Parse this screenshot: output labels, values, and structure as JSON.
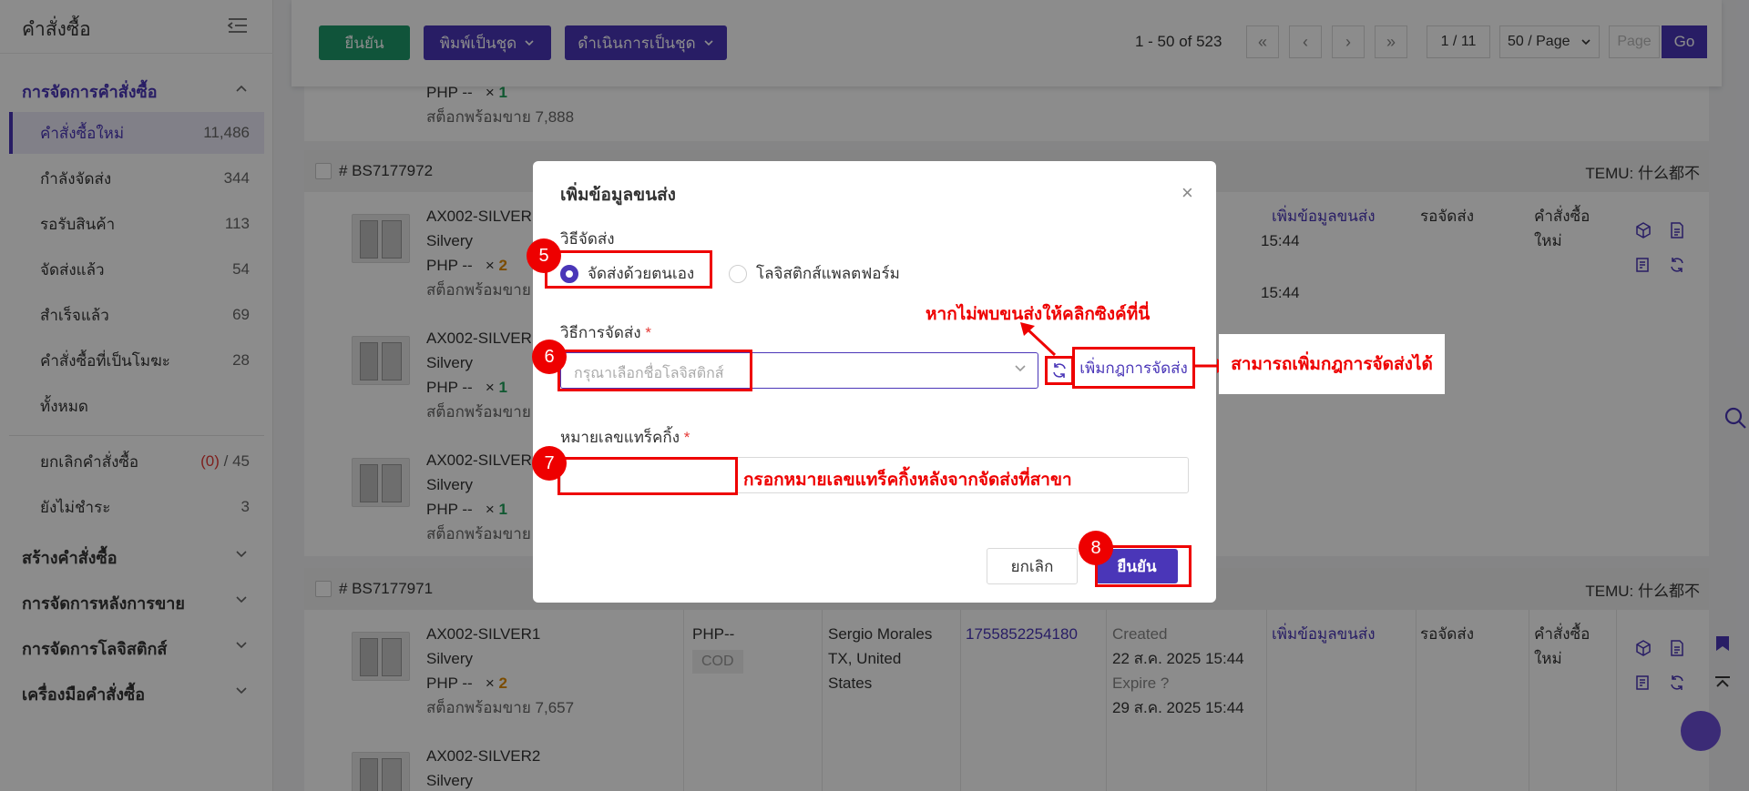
{
  "sidebar": {
    "title": "คำสั่งซื้อ",
    "section_active": "การจัดการคำสั่งซื้อ",
    "items": [
      {
        "label": "คำสั่งซื้อใหม่",
        "count": "11,486"
      },
      {
        "label": "กำลังจัดส่ง",
        "count": "344"
      },
      {
        "label": "รอรับสินค้า",
        "count": "113"
      },
      {
        "label": "จัดส่งแล้ว",
        "count": "54"
      },
      {
        "label": "สำเร็จแล้ว",
        "count": "69"
      },
      {
        "label": "คำสั่งซื้อที่เป็นโมฆะ",
        "count": "28"
      },
      {
        "label": "ทั้งหมด",
        "count": ""
      }
    ],
    "cancel_label": "ยกเลิกคำสั่งซื้อ",
    "cancel_count_red": "(0)",
    "cancel_total": "/ 45",
    "unpaid_label": "ยังไม่ชำระ",
    "unpaid_count": "3",
    "sections": [
      "สร้างคำสั่งซื้อ",
      "การจัดการหลังการขาย",
      "การจัดการโลจิสติกส์",
      "เครื่องมือคำสั่งซื้อ"
    ]
  },
  "toolbar": {
    "confirm": "ยืนยัน",
    "batch_print": "พิมพ์เป็นชุด",
    "batch_process": "ดำเนินการเป็นชุด",
    "range": "1 - 50 of 523",
    "page_display": "1 / 11",
    "page_size": "50 / Page",
    "page_placeholder": "Page",
    "go": "Go"
  },
  "orders": {
    "top_partial": {
      "price_line": "PHP --",
      "qty": "1",
      "stock": "สต็อกพร้อมขาย 7,888"
    },
    "order1": {
      "number": "# BS7177972",
      "shop": "TEMU: 什么都不",
      "products": [
        {
          "sku": "AX002-SILVER",
          "variant": "Silvery",
          "price": "PHP --",
          "qty": "2",
          "stock": "สต็อกพร้อมขาย"
        },
        {
          "sku": "AX002-SILVER",
          "variant": "Silvery",
          "price": "PHP --",
          "qty": "1",
          "stock": "สต็อกพร้อมขาย"
        },
        {
          "sku": "AX002-SILVER",
          "variant": "Silvery",
          "price": "PHP --",
          "qty": "1",
          "stock": "สต็อกพร้อมขาย"
        }
      ],
      "time1": "15:44",
      "time2": "15:44",
      "action": "เพิ่มข้อมูลขนส่ง",
      "status": "รอจัดส่ง",
      "type_line1": "คำสั่งซื้อ",
      "type_line2": "ใหม่"
    },
    "order2": {
      "number": "# BS7177971",
      "shop": "TEMU: 什么都不",
      "products": [
        {
          "sku": "AX002-SILVER1",
          "variant": "Silvery",
          "price": "PHP --",
          "qty": "2",
          "stock": "สต็อกพร้อมขาย 7,657"
        },
        {
          "sku": "AX002-SILVER2",
          "variant": "Silvery"
        }
      ],
      "amount": "PHP--",
      "payment": "COD",
      "buyer_name": "Sergio Morales",
      "buyer_region": "TX, United",
      "buyer_country": "States",
      "order_id": "1755852254180",
      "created_label": "Created",
      "created_date": "22 ส.ค. 2025 15:44",
      "expire_label": "Expire",
      "expire_date": "29 ส.ค. 2025 15:44",
      "action": "เพิ่มข้อมูลขนส่ง",
      "status": "รอจัดส่ง",
      "type_line1": "คำสั่งซื้อ",
      "type_line2": "ใหม่"
    },
    "times_symbol": "×"
  },
  "modal": {
    "title": "เพิ่มข้อมูลขนส่ง",
    "close": "×",
    "shipping_method_label": "วิธีจัดส่ง",
    "option_self": "จัดส่งด้วยตนเอง",
    "option_platform": "โลจิสติกส์แพลตฟอร์ม",
    "delivery_label": "วิธีการจัดส่ง",
    "delivery_placeholder": "กรุณาเลือกชื่อโลจิสติกส์",
    "add_rule": "เพิ่มกฎการจัดส่ง",
    "tracking_label": "หมายเลขแทร็คกิ้ง",
    "required_mark": "*",
    "cancel": "ยกเลิก",
    "confirm": "ยืนยัน"
  },
  "annotations": {
    "badge5": "5",
    "badge6": "6",
    "badge7": "7",
    "badge8": "8",
    "sync_hint": "หากไม่พบขนส่งให้คลิกซิงค์ที่นี่",
    "rule_hint": "สามารถเพิ่มกฎการจัดส่งได้",
    "tracking_hint": "กรอกหมายเลขแทร็คกิ้งหลังจากจัดส่งที่สาขา"
  },
  "colors": {
    "brand": "#4a36b8",
    "confirm_green": "#1e9a6a",
    "annotation_red": "#e00000"
  }
}
